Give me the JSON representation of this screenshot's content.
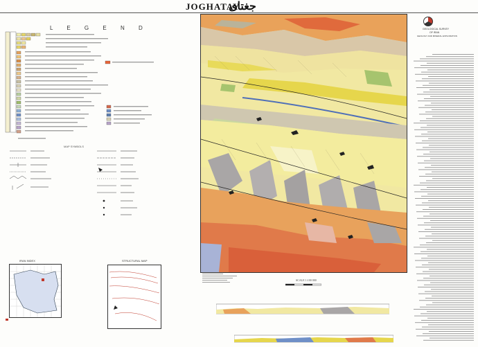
{
  "header": {
    "title_en": "JOGHATAY",
    "title_fa": "جغتای"
  },
  "legend": {
    "heading": "L E G E N D",
    "structural_heading": "MAP SYMBOLS"
  },
  "insets": {
    "index_map_label": "IRAN INDEX",
    "structural_map_label": "STRUCTURAL MAP"
  },
  "organization": {
    "name_line1": "GEOLOGICAL SURVEY",
    "name_line2": "OF IRAN",
    "name_line3": "GEOLOGY AND MINERAL EXPLORATION"
  },
  "scale": {
    "label": "SCALE 1:100 000"
  },
  "colors": {
    "map_base": "#f2eaa0",
    "orange_unit": "#e8a25c",
    "red_unit": "#d9603a",
    "grey_unit": "#a9a6a6",
    "green_unit": "#9fbf6a",
    "blue_unit": "#6f8fc7",
    "yellow_unit": "#e9dc55",
    "pink_unit": "#e7b7a5"
  }
}
